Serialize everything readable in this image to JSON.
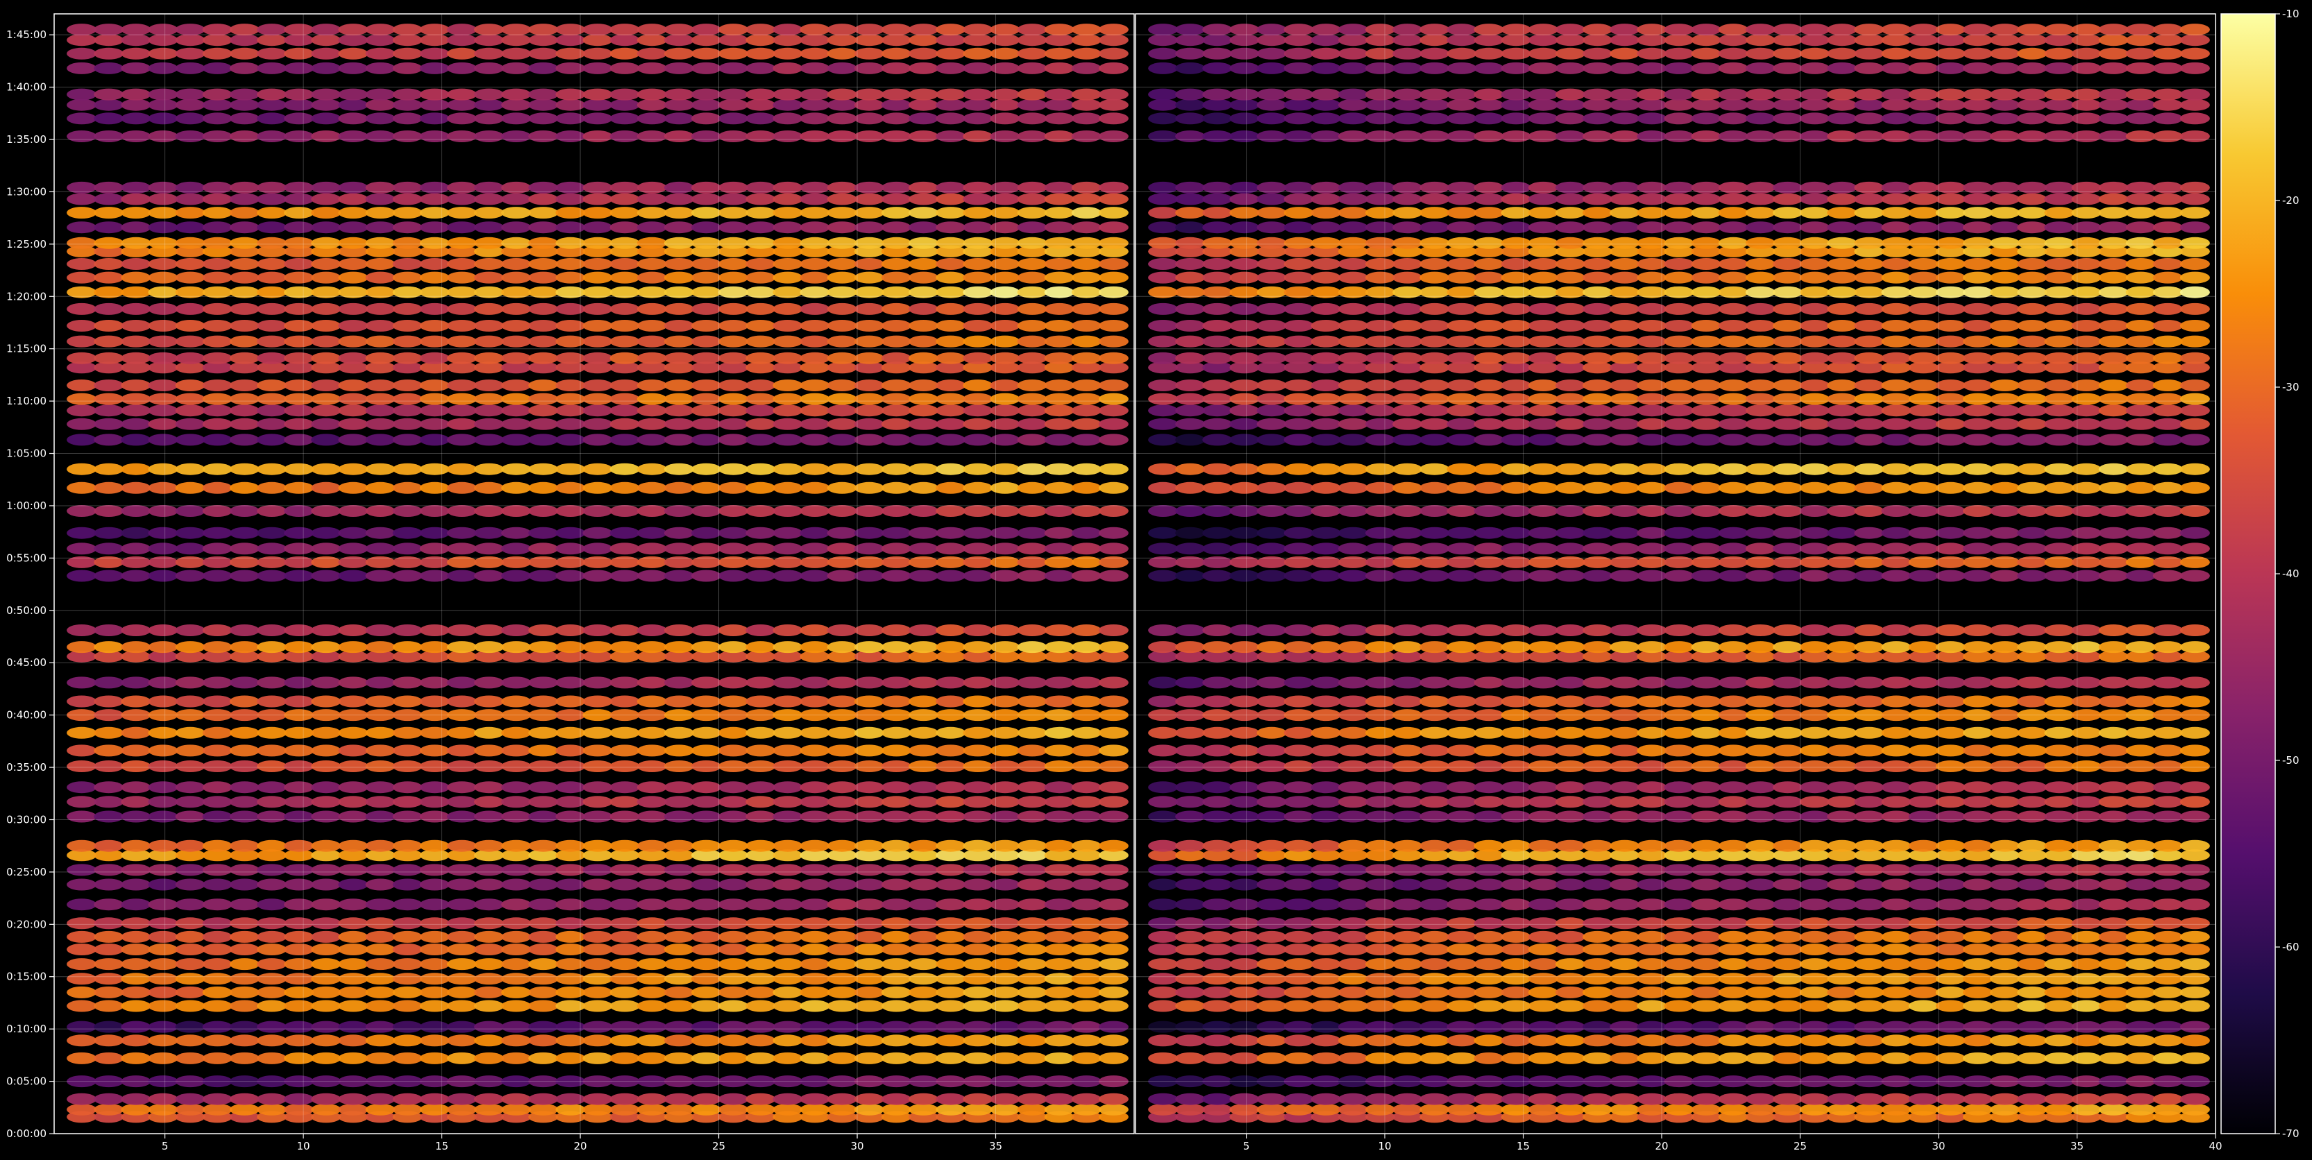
{
  "chart_data": {
    "type": "heatmap",
    "title": "",
    "xlabel": "",
    "ylabel": "",
    "colormap": "inferno",
    "background": "#000000",
    "grid": true,
    "panels": [
      {
        "xlim": [
          1,
          40
        ],
        "xticks": [
          5,
          10,
          15,
          20,
          25,
          30,
          35
        ]
      },
      {
        "xlim": [
          1,
          40
        ],
        "xticks": [
          5,
          10,
          15,
          20,
          25,
          30,
          35,
          40
        ]
      }
    ],
    "ylim_minutes": [
      0,
      107
    ],
    "yticks": [
      "0:00:00",
      "0:05:00",
      "0:10:00",
      "0:15:00",
      "0:20:00",
      "0:25:00",
      "0:30:00",
      "0:35:00",
      "0:40:00",
      "0:45:00",
      "0:50:00",
      "0:55:00",
      "1:00:00",
      "1:05:00",
      "1:10:00",
      "1:15:00",
      "1:20:00",
      "1:25:00",
      "1:30:00",
      "1:35:00",
      "1:40:00",
      "1:45:00"
    ],
    "colorbar": {
      "range": [
        -70,
        -10
      ],
      "ticks": [
        -10,
        -20,
        -30,
        -40,
        -50,
        -60,
        -70
      ]
    },
    "bands": [
      {
        "t": 1.6,
        "v": -35
      },
      {
        "t": 2.3,
        "v": -30
      },
      {
        "t": 3.3,
        "v": -45
      },
      {
        "t": 5.0,
        "v": -56
      },
      {
        "t": 7.2,
        "v": -28
      },
      {
        "t": 8.9,
        "v": -31
      },
      {
        "t": 10.2,
        "v": -58
      },
      {
        "t": 12.2,
        "v": -27
      },
      {
        "t": 13.5,
        "v": -30
      },
      {
        "t": 14.8,
        "v": -29
      },
      {
        "t": 16.2,
        "v": -30
      },
      {
        "t": 17.6,
        "v": -33
      },
      {
        "t": 18.8,
        "v": -34
      },
      {
        "t": 20.1,
        "v": -40
      },
      {
        "t": 21.9,
        "v": -50
      },
      {
        "t": 23.8,
        "v": -52
      },
      {
        "t": 25.2,
        "v": -48
      },
      {
        "t": 26.6,
        "v": -24
      },
      {
        "t": 27.5,
        "v": -30
      },
      {
        "t": 30.3,
        "v": -50
      },
      {
        "t": 31.7,
        "v": -44
      },
      {
        "t": 33.1,
        "v": -48
      },
      {
        "t": 35.1,
        "v": -36
      },
      {
        "t": 36.6,
        "v": -33
      },
      {
        "t": 38.3,
        "v": -27
      },
      {
        "t": 40.0,
        "v": -32
      },
      {
        "t": 41.3,
        "v": -35
      },
      {
        "t": 43.1,
        "v": -48
      },
      {
        "t": 45.6,
        "v": -37
      },
      {
        "t": 46.5,
        "v": -27
      },
      {
        "t": 48.1,
        "v": -42
      },
      {
        "t": 53.3,
        "v": -54
      },
      {
        "t": 54.6,
        "v": -37
      },
      {
        "t": 55.9,
        "v": -50
      },
      {
        "t": 57.4,
        "v": -56
      },
      {
        "t": 59.5,
        "v": -46
      },
      {
        "t": 61.7,
        "v": -30
      },
      {
        "t": 63.5,
        "v": -24
      },
      {
        "t": 66.3,
        "v": -55
      },
      {
        "t": 67.8,
        "v": -45
      },
      {
        "t": 69.1,
        "v": -43
      },
      {
        "t": 70.2,
        "v": -33
      },
      {
        "t": 71.5,
        "v": -36
      },
      {
        "t": 73.2,
        "v": -40
      },
      {
        "t": 74.1,
        "v": -38
      },
      {
        "t": 75.7,
        "v": -35
      },
      {
        "t": 77.2,
        "v": -37
      },
      {
        "t": 78.8,
        "v": -40
      },
      {
        "t": 80.4,
        "v": -22
      },
      {
        "t": 81.8,
        "v": -32
      },
      {
        "t": 83.1,
        "v": -35
      },
      {
        "t": 84.3,
        "v": -28
      },
      {
        "t": 85.1,
        "v": -27
      },
      {
        "t": 86.6,
        "v": -52
      },
      {
        "t": 88.0,
        "v": -26
      },
      {
        "t": 89.3,
        "v": -45
      },
      {
        "t": 90.4,
        "v": -48
      },
      {
        "t": 95.3,
        "v": -48
      },
      {
        "t": 97.0,
        "v": -52
      },
      {
        "t": 98.3,
        "v": -50
      },
      {
        "t": 99.3,
        "v": -46
      },
      {
        "t": 101.8,
        "v": -50
      },
      {
        "t": 103.2,
        "v": -40
      },
      {
        "t": 104.5,
        "v": -42
      },
      {
        "t": 105.5,
        "v": -42
      }
    ]
  }
}
